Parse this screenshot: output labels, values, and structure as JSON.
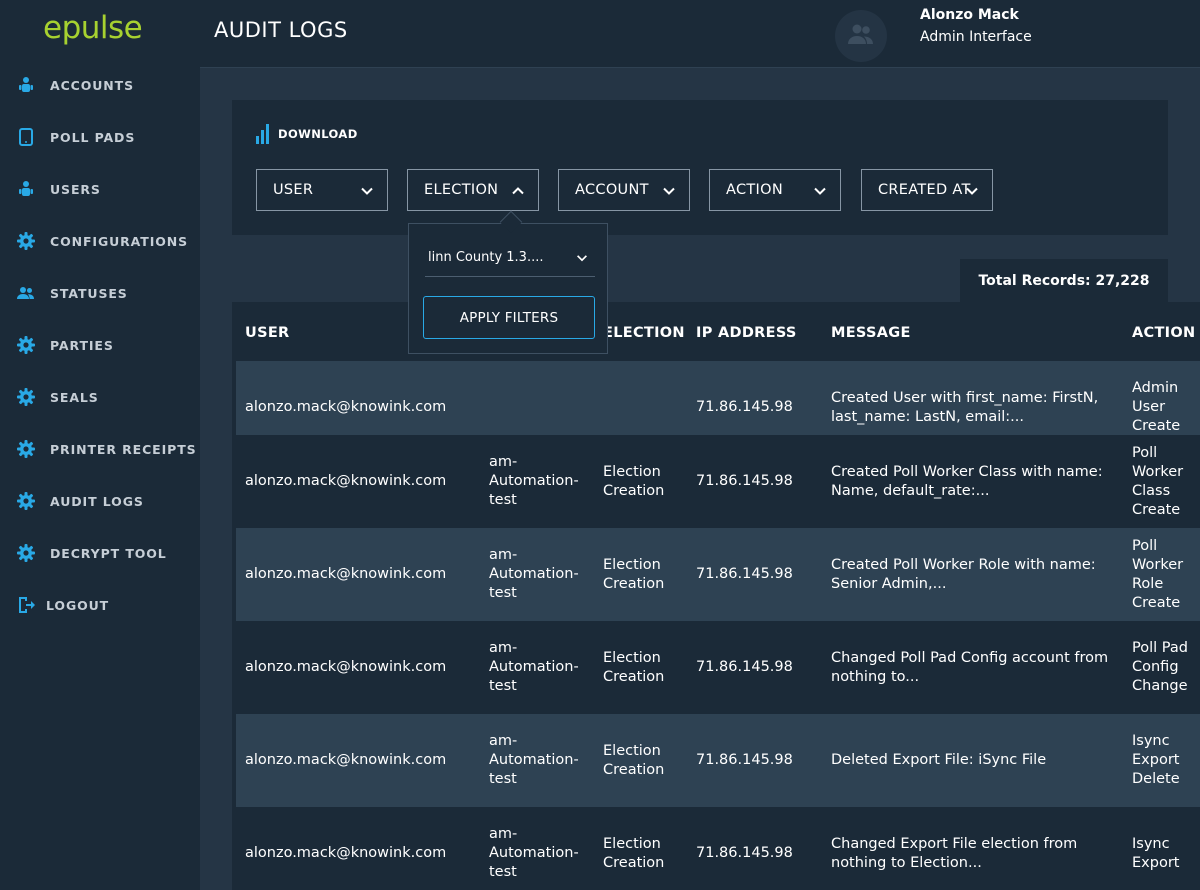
{
  "brand": {
    "logo_text": "epulse",
    "accent": "#a7d130",
    "link_blue": "#29a9e6"
  },
  "sidebar": {
    "items": [
      {
        "label": "ACCOUNTS",
        "icon": "accounts-icon"
      },
      {
        "label": "POLL PADS",
        "icon": "tablet-icon"
      },
      {
        "label": "USERS",
        "icon": "users-icon"
      },
      {
        "label": "CONFIGURATIONS",
        "icon": "gear-icon"
      },
      {
        "label": "STATUSES",
        "icon": "people-icon"
      },
      {
        "label": "PARTIES",
        "icon": "gear-icon"
      },
      {
        "label": "SEALS",
        "icon": "gear-icon"
      },
      {
        "label": "PRINTER RECEIPTS",
        "icon": "gear-icon"
      },
      {
        "label": "AUDIT LOGS",
        "icon": "gear-icon"
      },
      {
        "label": "DECRYPT TOOL",
        "icon": "gear-icon"
      },
      {
        "label": "LOGOUT",
        "icon": "logout-icon"
      }
    ]
  },
  "header": {
    "title": "AUDIT LOGS",
    "user_name": "Alonzo Mack",
    "user_role": "Admin Interface"
  },
  "filters": {
    "download_label": "DOWNLOAD",
    "buttons": [
      {
        "label": "USER",
        "open": false
      },
      {
        "label": "ELECTION",
        "open": true
      },
      {
        "label": "ACCOUNT",
        "open": false
      },
      {
        "label": "ACTION",
        "open": false
      },
      {
        "label": "CREATED AT",
        "open": false
      }
    ],
    "popover": {
      "selected_value": "linn County 1.3....",
      "apply_label": "APPLY FILTERS"
    }
  },
  "total_records": "Total Records: 27,228",
  "table": {
    "headers": [
      "USER",
      "ELECTION",
      "IP ADDRESS",
      "MESSAGE",
      "ACTION"
    ],
    "rows": [
      {
        "user": "alonzo.mack@knowink.com",
        "account": "",
        "election": "",
        "ip": "71.86.145.98",
        "message": "Created User with first_name: FirstN, last_name: LastN, email:...",
        "action": "Admin User Create"
      },
      {
        "user": "alonzo.mack@knowink.com",
        "account": "am-Automation-test",
        "election": "Election Creation",
        "ip": "71.86.145.98",
        "message": "Created Poll Worker Class with name: Name, default_rate:...",
        "action": "Poll Worker Class Create"
      },
      {
        "user": "alonzo.mack@knowink.com",
        "account": "am-Automation-test",
        "election": "Election Creation",
        "ip": "71.86.145.98",
        "message": "Created Poll Worker Role with name: Senior Admin,...",
        "action": "Poll Worker Role Create"
      },
      {
        "user": "alonzo.mack@knowink.com",
        "account": "am-Automation-test",
        "election": "Election Creation",
        "ip": "71.86.145.98",
        "message": "Changed Poll Pad Config account from nothing to...",
        "action": "Poll Pad Config Change"
      },
      {
        "user": "alonzo.mack@knowink.com",
        "account": "am-Automation-test",
        "election": "Election Creation",
        "ip": "71.86.145.98",
        "message": "Deleted Export File: iSync File",
        "action": "Isync Export Delete"
      },
      {
        "user": "alonzo.mack@knowink.com",
        "account": "am-Automation-test",
        "election": "Election Creation",
        "ip": "71.86.145.98",
        "message": "Changed Export File election from nothing to Election...",
        "action": "Isync Export"
      }
    ]
  }
}
